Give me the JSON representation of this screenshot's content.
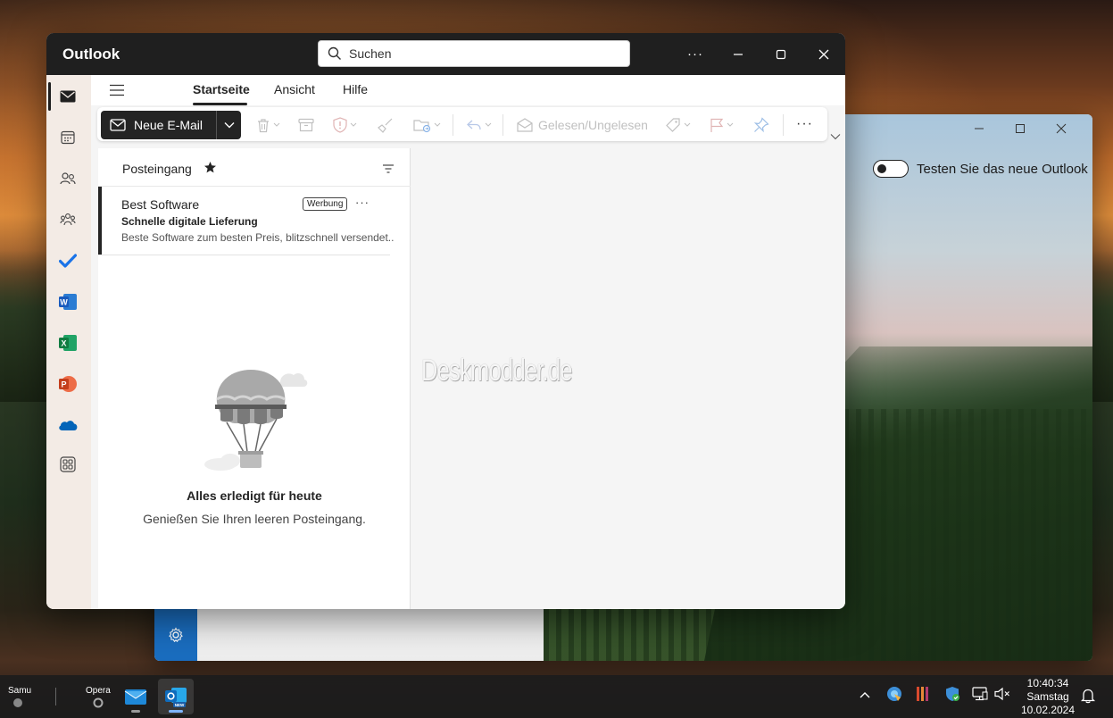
{
  "window": {
    "app_title": "Outlook",
    "search_placeholder": "Suchen",
    "more_label": "···"
  },
  "menu": {
    "tabs": [
      {
        "label": "Startseite",
        "active": true
      },
      {
        "label": "Ansicht",
        "active": false
      },
      {
        "label": "Hilfe",
        "active": false
      }
    ]
  },
  "toolbar": {
    "new_mail_label": "Neue E-Mail",
    "read_unread_label": "Gelesen/Ungelesen",
    "more_label": "···"
  },
  "rail": {
    "items": [
      "mail-icon",
      "calendar-icon",
      "people-icon",
      "groups-icon",
      "todo-icon",
      "word-icon",
      "excel-icon",
      "powerpoint-icon",
      "onedrive-icon",
      "apps-icon"
    ]
  },
  "mail_list": {
    "folder_name": "Posteingang",
    "items": [
      {
        "sender": "Best Software",
        "badge": "Werbung",
        "subject": "Schnelle digitale Lieferung",
        "preview": "Beste Software zum besten Preis, blitzschnell versendet..."
      }
    ],
    "empty_title": "Alles erledigt für heute",
    "empty_subtitle": "Genießen Sie Ihren leeren Posteingang."
  },
  "reading_pane": {
    "watermark": "Deskmodder.de"
  },
  "background_window": {
    "toggle_label": "Testen Sie das neue Outlook"
  },
  "taskbar": {
    "weather_label": "Samu",
    "opera_label": "Opera",
    "clock_time": "10:40:34",
    "clock_day": "Samstag",
    "clock_date": "10.02.2024"
  },
  "colors": {
    "titlebar": "#1f1f1f",
    "accent_dark": "#242424",
    "rail_bg": "#f3ebe5",
    "todo_blue": "#1a73e8",
    "word_blue": "#185abd",
    "excel_green": "#107c41",
    "powerpoint_red": "#c43e1c",
    "onedrive_blue": "#0364b8"
  }
}
